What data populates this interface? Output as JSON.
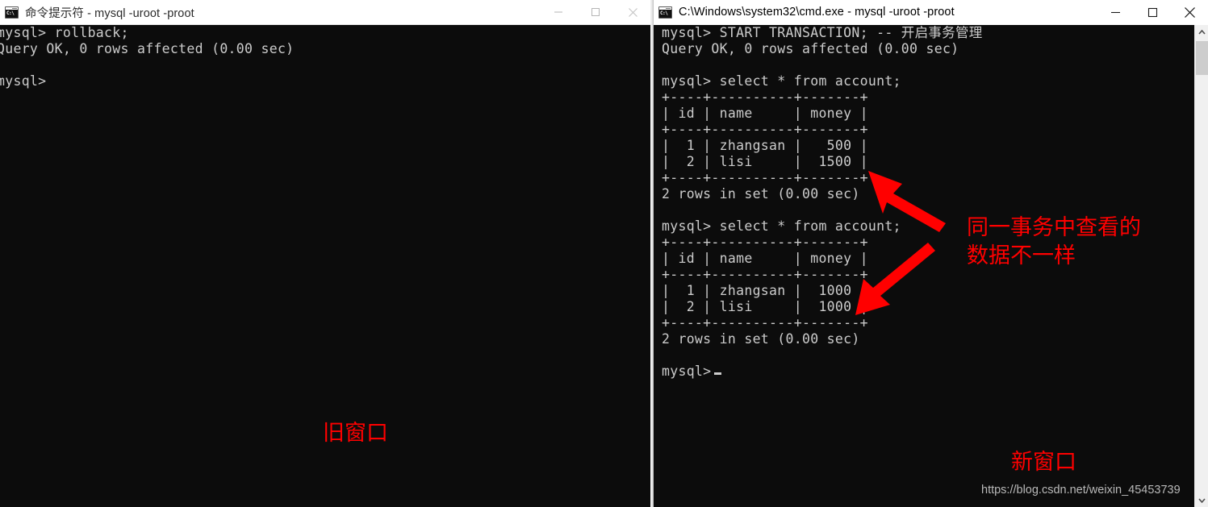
{
  "windows": {
    "old": {
      "title": "命令提示符 - mysql  -uroot -proot",
      "icon_name": "cmd-icon",
      "icon_text": "C:\\",
      "terminal_lines": [
        "mysql> rollback;",
        "Query OK, 0 rows affected (0.00 sec)",
        "",
        "mysql>"
      ],
      "controls": {
        "minimize": "minimize",
        "maximize": "maximize",
        "close": "close"
      }
    },
    "new": {
      "title": "C:\\Windows\\system32\\cmd.exe - mysql  -uroot -proot",
      "icon_name": "cmd-icon",
      "icon_text": "C:\\",
      "terminal_lines": [
        "mysql> START TRANSACTION; -- 开启事务管理",
        "Query OK, 0 rows affected (0.00 sec)",
        "",
        "mysql> select * from account;",
        "+----+----------+-------+",
        "| id | name     | money |",
        "+----+----------+-------+",
        "|  1 | zhangsan |   500 |",
        "|  2 | lisi     |  1500 |",
        "+----+----------+-------+",
        "2 rows in set (0.00 sec)",
        "",
        "mysql> select * from account;",
        "+----+----------+-------+",
        "| id | name     | money |",
        "+----+----------+-------+",
        "|  1 | zhangsan |  1000 |",
        "|  2 | lisi     |  1000 |",
        "+----+----------+-------+",
        "2 rows in set (0.00 sec)",
        "",
        "mysql>"
      ],
      "prompt_cursor": true,
      "controls": {
        "minimize": "minimize",
        "maximize": "maximize",
        "close": "close"
      },
      "scrollbar": {
        "up_arrow": "⌃",
        "down_arrow": "⌄"
      }
    }
  },
  "annotations": {
    "note_diff": "同一事务中查看的\n数据不一样",
    "old_window": "旧窗口",
    "new_window": "新窗口",
    "arrow_color": "#ff0000"
  },
  "watermark": "https://blog.csdn.net/weixin_45453739",
  "colors": {
    "terminal_bg": "#0c0c0c",
    "terminal_fg": "#cccccc",
    "titlebar_bg": "#ffffff",
    "annotation_red": "#ff0000",
    "scrollbar_track": "#f0f0f0",
    "scrollbar_thumb": "#cdcdcd"
  }
}
